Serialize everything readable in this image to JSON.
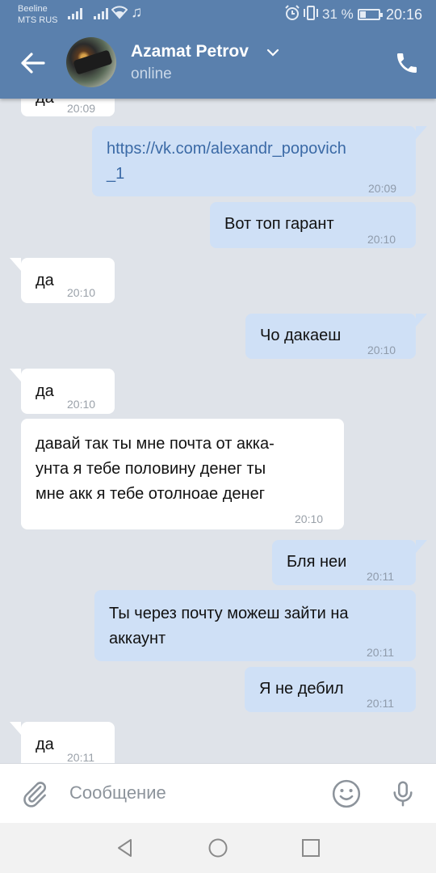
{
  "status_bar": {
    "carrier_1": "Beeline",
    "carrier_2": "MTS RUS",
    "battery_percent": "31 %",
    "battery_level": 0.31,
    "time": "20:16"
  },
  "header": {
    "contact_name": "Azamat Petrov",
    "contact_status": "online",
    "icons": [
      "back-arrow-icon",
      "chevron-down-icon",
      "phone-icon"
    ],
    "bar_color": "#5a80ad"
  },
  "messages": [
    {
      "direction": "in",
      "text": "да",
      "time": "20:09"
    },
    {
      "direction": "out",
      "text": "https://vk.com/alexandr_popovich_1",
      "line1": "https://vk.com/alexandr_popovich",
      "line2": "_1",
      "time": "20:09"
    },
    {
      "direction": "out",
      "text": "Вот топ гарант",
      "time": "20:10"
    },
    {
      "direction": "in",
      "text": "да",
      "time": "20:10"
    },
    {
      "direction": "out",
      "text": "Чо дакаеш",
      "time": "20:10"
    },
    {
      "direction": "in",
      "text": "да",
      "time": "20:10"
    },
    {
      "direction": "in",
      "line1": "давай так ты мне почта от акка-",
      "line2": "унта я тебе половину денег ты",
      "line3": "мне акк я тебе отолноае денег",
      "time": "20:10"
    },
    {
      "direction": "out",
      "text": "Бля неи",
      "time": "20:11"
    },
    {
      "direction": "out",
      "line1": "Ты через почту можеш зайти на",
      "line2": "аккаунт",
      "time": "20:11"
    },
    {
      "direction": "out",
      "text": "Я не дебил",
      "time": "20:11"
    },
    {
      "direction": "in",
      "text": "да",
      "time": "20:11"
    }
  ],
  "composer": {
    "placeholder": "Сообщение",
    "icons": [
      "paperclip-icon",
      "emoji-icon",
      "microphone-icon"
    ]
  },
  "nav_bar": {
    "icons": [
      "back-triangle-icon",
      "home-circle-icon",
      "recents-square-icon"
    ]
  }
}
